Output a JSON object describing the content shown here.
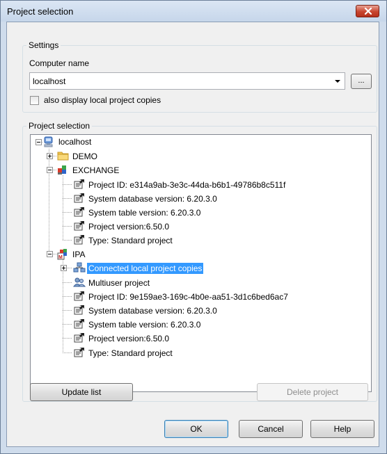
{
  "window": {
    "title": "Project selection"
  },
  "settings": {
    "legend": "Settings",
    "computer_name_label": "Computer name",
    "computer_name_value": "localhost",
    "browse_label": "...",
    "checkbox_label": "also display local project copies",
    "checkbox_checked": false
  },
  "project_selection": {
    "legend": "Project selection",
    "tree": {
      "root": "localhost",
      "demo": "DEMO",
      "exchange": "EXCHANGE",
      "exchange_children": [
        "Project ID: e314a9ab-3e3c-44da-b6b1-49786b8c511f",
        "System database version: 6.20.3.0",
        "System table version: 6.20.3.0",
        "Project version:6.50.0",
        "Type: Standard project"
      ],
      "ipa": "IPA",
      "ipa_children": [
        "Connected local project copies",
        "Multiuser project",
        "Project ID: 9e159ae3-169c-4b0e-aa51-3d1c6bed6ac7",
        "System database version: 6.20.3.0",
        "System table version: 6.20.3.0",
        "Project version:6.50.0",
        "Type: Standard project"
      ]
    }
  },
  "buttons": {
    "update_list": "Update list",
    "delete_project": "Delete project",
    "ok": "OK",
    "cancel": "Cancel",
    "help": "Help"
  },
  "colors": {
    "selection": "#3399ff",
    "close_button": "#c8452f"
  }
}
